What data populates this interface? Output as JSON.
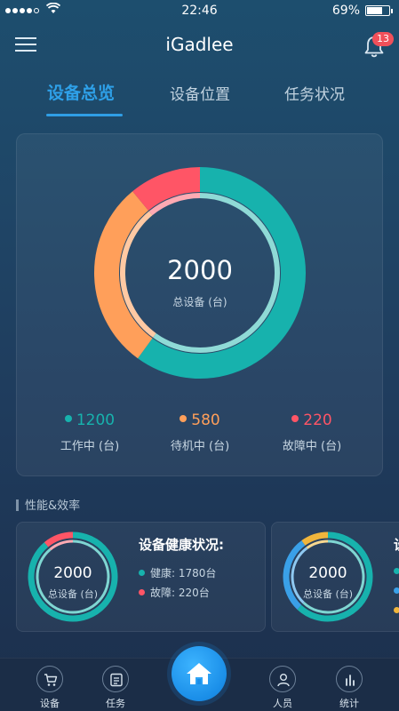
{
  "status_bar": {
    "time": "22:46",
    "battery": "69%"
  },
  "header": {
    "title": "iGadlee",
    "notification_count": "13"
  },
  "tabs": [
    {
      "label": "设备总览",
      "active": true
    },
    {
      "label": "设备位置",
      "active": false
    },
    {
      "label": "任务状况",
      "active": false
    }
  ],
  "overview": {
    "total_value": "2000",
    "total_label": "总设备 (台)",
    "stats": [
      {
        "value": "1200",
        "label": "工作中 (台)",
        "color": "#17b2ad"
      },
      {
        "value": "580",
        "label": "待机中 (台)",
        "color": "#ff9f5a"
      },
      {
        "value": "220",
        "label": "故障中 (台)",
        "color": "#ff5566"
      }
    ]
  },
  "section": {
    "title": "性能&效率"
  },
  "health_card": {
    "total_value": "2000",
    "total_label": "总设备 (台)",
    "title": "设备健康状况:",
    "legend": [
      {
        "label": "健康: 1780台",
        "color": "#17b2ad",
        "value": 1780
      },
      {
        "label": "故障: 220台",
        "color": "#ff5566",
        "value": 220
      }
    ]
  },
  "second_card": {
    "total_value": "2000",
    "total_label": "总设备 (台)",
    "title_partial": "设",
    "legend_colors": [
      "#17b2ad",
      "#3aa0e8",
      "#f0b53c"
    ]
  },
  "bottom_nav": [
    {
      "label": "设备",
      "icon": "cart-icon"
    },
    {
      "label": "任务",
      "icon": "task-list-icon"
    },
    {
      "label": "",
      "icon": "home-icon"
    },
    {
      "label": "人员",
      "icon": "person-icon"
    },
    {
      "label": "统计",
      "icon": "bar-chart-icon"
    }
  ]
}
